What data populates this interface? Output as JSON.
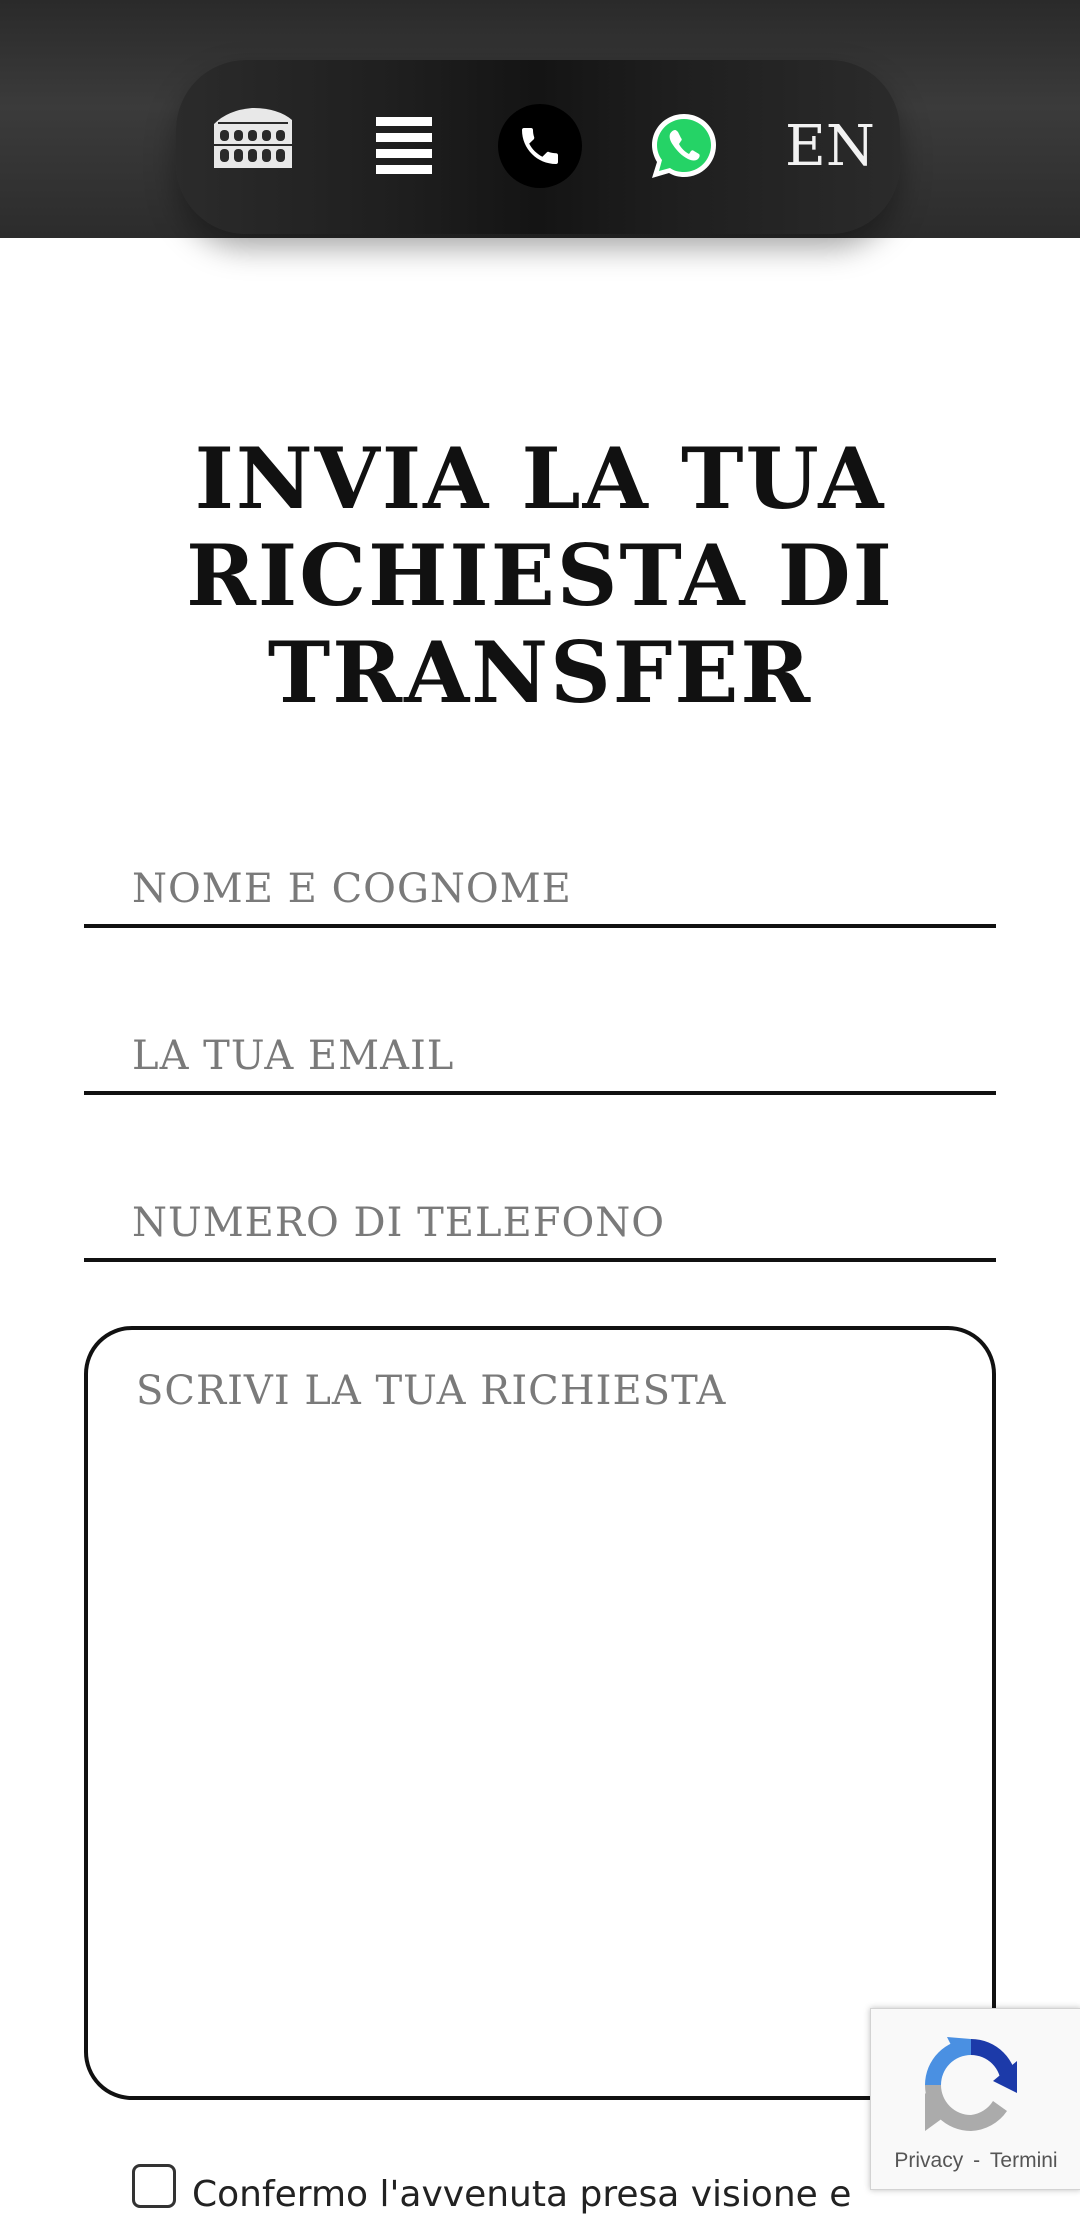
{
  "header": {
    "logo_icon": "colosseum-icon",
    "menu_icon": "hamburger-icon",
    "phone_icon": "phone-icon",
    "whatsapp_icon": "whatsapp-icon",
    "language": "EN"
  },
  "page": {
    "title": "INVIA LA TUA RICHIESTA DI TRANSFER"
  },
  "form": {
    "name_placeholder": "NOME E COGNOME",
    "email_placeholder": "LA TUA EMAIL",
    "phone_placeholder": "NUMERO DI TELEFONO",
    "message_placeholder": "SCRIVI LA TUA RICHIESTA",
    "consent_text": "Confermo l'avvenuta presa visione e"
  },
  "recaptcha": {
    "privacy": "Privacy",
    "separator": "-",
    "terms": "Termini"
  },
  "colors": {
    "header_bg": "#333333",
    "whatsapp_green": "#25D366",
    "text": "#111111"
  }
}
